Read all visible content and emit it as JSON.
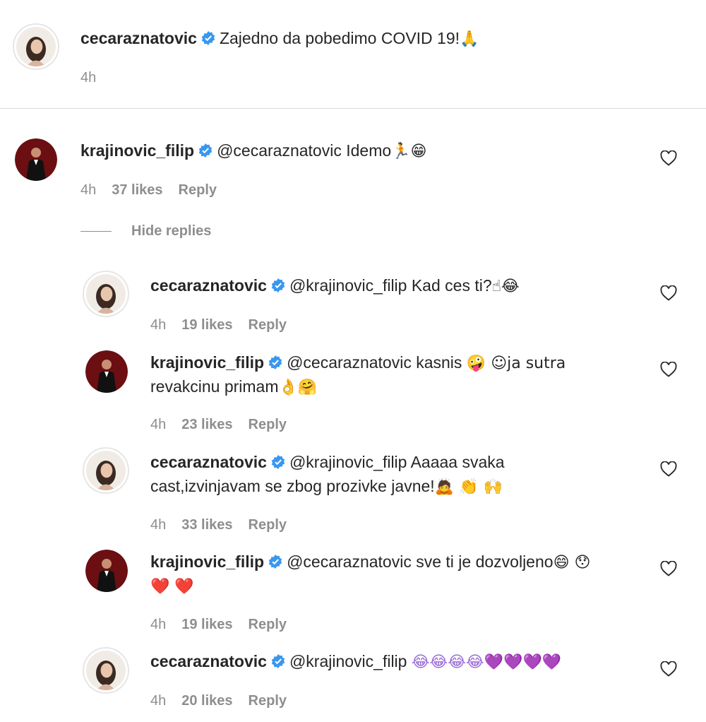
{
  "caption": {
    "username": "cecaraznatovic",
    "text": "Zajedno da pobedimo COVID 19!",
    "emoji": "🙏",
    "time": "4h"
  },
  "comment": {
    "username": "krajinovic_filip",
    "mention": "@cecaraznatovic",
    "text": "Idemo",
    "emoji": "🏃😁",
    "time": "4h",
    "likes": "37 likes",
    "reply": "Reply"
  },
  "hide_replies": "Hide replies",
  "replies": [
    {
      "username": "cecaraznatovic",
      "mention": "@krajinovic_filip",
      "line1": "Kad ces ti?",
      "emoji1": "☝😂",
      "line2": "",
      "emoji2": "",
      "time": "4h",
      "likes": "19 likes",
      "reply": "Reply"
    },
    {
      "username": "krajinovic_filip",
      "mention": "@cecaraznatovic",
      "line1": "kasnis",
      "emoji1": "🤪 ☺ja sutra",
      "line2": "revakcinu primam",
      "emoji2": "👌🤗",
      "time": "4h",
      "likes": "23 likes",
      "reply": "Reply"
    },
    {
      "username": "cecaraznatovic",
      "mention": "@krajinovic_filip",
      "line1": "Aaaaa svaka",
      "emoji1": "",
      "line2": "cast,izvinjavam se zbog prozivke javne!",
      "emoji2": "🙇 👏 🙌",
      "time": "4h",
      "likes": "33 likes",
      "reply": "Reply"
    },
    {
      "username": "krajinovic_filip",
      "mention": "@cecaraznatovic",
      "line1": "sve ti je dozvoljeno",
      "emoji1": "😄 😯",
      "line2": "",
      "emoji2": "❤️ ❤️",
      "time": "4h",
      "likes": "19 likes",
      "reply": "Reply"
    },
    {
      "username": "cecaraznatovic",
      "mention": "@krajinovic_filip",
      "line1": "",
      "emoji1": "😂😂😂😂💜💜💜💜",
      "line2": "",
      "emoji2": "",
      "time": "4h",
      "likes": "20 likes",
      "reply": "Reply"
    }
  ],
  "colors": {
    "verified": "#3897f0",
    "muted": "#8e8e8e",
    "heart_red": "#ed4956"
  }
}
